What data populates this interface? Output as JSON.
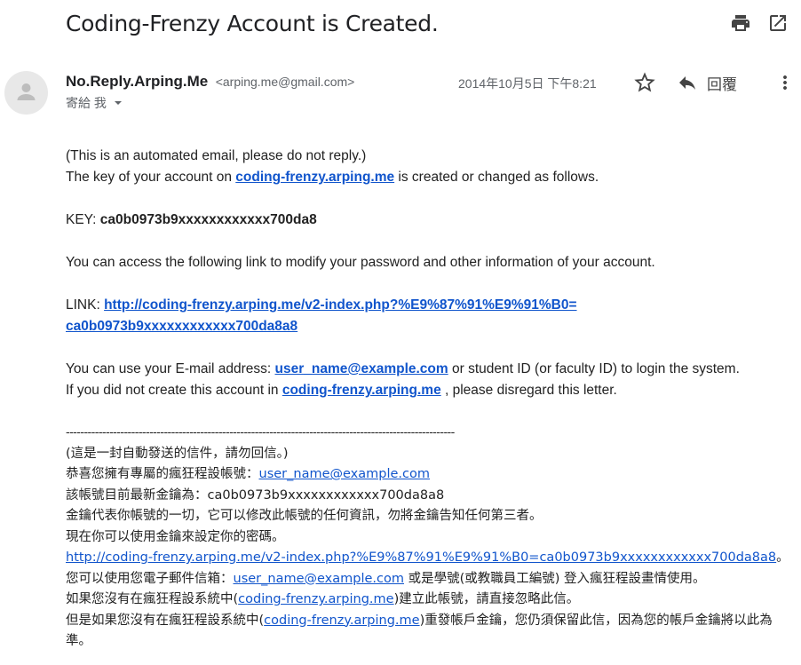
{
  "email": {
    "subject": "Coding-Frenzy Account is Created.",
    "sender_name": "No.Reply.Arping.Me",
    "sender_email": "<arping.me@gmail.com>",
    "to_label": "寄給 我",
    "date": "2014年10月5日 下午8:21",
    "reply_label": "回覆"
  },
  "icons": {
    "print": "print-icon",
    "open_new_window": "open-in-new-window-icon",
    "star": "star-icon",
    "reply": "reply-icon",
    "more": "more-vert-icon",
    "avatar": "default-avatar-icon",
    "dropdown": "chevron-down-icon"
  },
  "body_en": {
    "line1": "(This is an automated email, please do not reply.)",
    "line2_pre": "The key of your account on ",
    "site_link": "coding-frenzy.arping.me",
    "line2_post": " is created or changed as follows.",
    "key_label": "KEY: ",
    "key_value": "ca0b0973b9xxxxxxxxxxxx700da8",
    "line_access": "You can access the following link to modify your password and other information of your account.",
    "link_label": "LINK: ",
    "link_part1": "http://coding-frenzy.arping.me/v2-index.php?%E9%87%91%E9%91%B0=",
    "link_part2": "ca0b0973b9xxxxxxxxxxxx700da8a8",
    "line_use_pre": "You can use your E-mail address: ",
    "user_email": "user_name@example.com",
    "line_use_post": " or student ID (or faculty ID) to login the system.",
    "line_ifnot_pre": "If you did not create this account in ",
    "line_ifnot_post": " , please disregard this letter."
  },
  "body_zh": {
    "divider": "-----------------------------------------------------------------------------------------------------------",
    "l1": "(這是一封自動發送的信件，請勿回信。)",
    "l2_pre": "恭喜您擁有專屬的瘋狂程設帳號：",
    "l3": "該帳號目前最新金鑰為：ca0b0973b9xxxxxxxxxxxx700da8a8",
    "l4": "金鑰代表你帳號的一切，它可以修改此帳號的任何資訊，勿將金鑰告知任何第三者。",
    "l5": "現在你可以使用金鑰來設定你的密碼。",
    "l6_link": "http://coding-frenzy.arping.me/v2-index.php?%E9%87%91%E9%91%B0=ca0b0973b9xxxxxxxxxxxx700da8a8",
    "l6_post": "。",
    "l7_pre": "您可以使用您電子郵件信箱：",
    "l7_post": " 或是學號(或教職員工編號) 登入瘋狂程設畫情使用。",
    "l8_pre": "如果您沒有在瘋狂程設系統中(",
    "l8_post": ")建立此帳號，請直接忽略此信。",
    "l9_pre": "但是如果您沒有在瘋狂程設系統中(",
    "l9_post": ")重發帳戶金鑰，您仍須保留此信，因為您的帳戶金鑰將以此為準。"
  }
}
